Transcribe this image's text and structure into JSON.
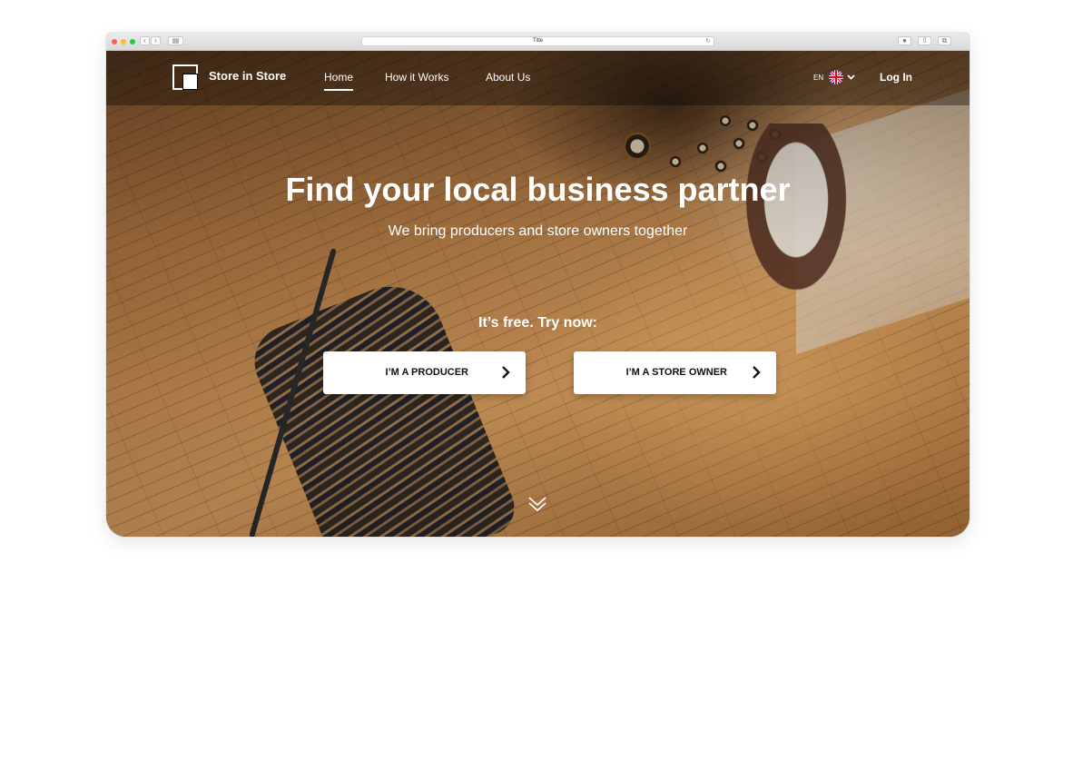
{
  "browser": {
    "tab_title": "Title"
  },
  "nav": {
    "brand": "Store in Store",
    "links": [
      {
        "label": "Home",
        "active": true
      },
      {
        "label": "How it Works",
        "active": false
      },
      {
        "label": "About Us",
        "active": false
      }
    ],
    "language": "EN",
    "language_flag_icon": "uk-flag-icon",
    "login_label": "Log In"
  },
  "hero": {
    "headline": "Find your local business partner",
    "subheadline": "We bring producers and store owners together",
    "tagline": "It’s free. Try now:",
    "buttons": [
      {
        "label": "I’M A PRODUCER",
        "icon": "chevron-right-icon"
      },
      {
        "label": "I’M A STORE OWNER",
        "icon": "chevron-right-icon"
      }
    ],
    "scroll_icon": "double-chevron-down-icon"
  },
  "colors": {
    "text_on_hero": "#ffffff",
    "button_bg": "#ffffff",
    "button_text": "#111111",
    "traffic_light_red": "#fc5f57",
    "traffic_light_yellow": "#fdbc2e",
    "traffic_light_green": "#29c940"
  }
}
